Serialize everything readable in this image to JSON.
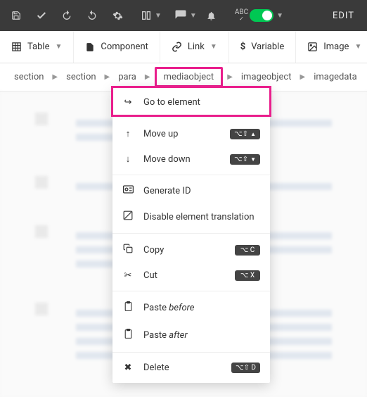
{
  "topbar": {
    "spellcheck": "ABC",
    "edit": "EDIT"
  },
  "toolbar": {
    "table": "Table",
    "component": "Component",
    "link": "Link",
    "variable": "Variable",
    "image": "Image"
  },
  "breadcrumb": {
    "items": [
      "section",
      "section",
      "para",
      "mediaobject",
      "imageobject",
      "imagedata"
    ],
    "highlighted_index": 3
  },
  "context_menu": {
    "go_to_element": "Go to element",
    "move_up": "Move up",
    "move_down": "Move down",
    "generate_id": "Generate ID",
    "disable_translation": "Disable element translation",
    "copy": "Copy",
    "cut": "Cut",
    "paste_before_pre": "Paste ",
    "paste_before_it": "before",
    "paste_after_pre": "Paste ",
    "paste_after_it": "after",
    "delete": "Delete",
    "shortcuts": {
      "move_up": "⌥⇧",
      "move_down": "⌥⇧",
      "copy": "⌥ C",
      "cut": "⌥ X",
      "delete": "⌥⇧ D"
    }
  }
}
